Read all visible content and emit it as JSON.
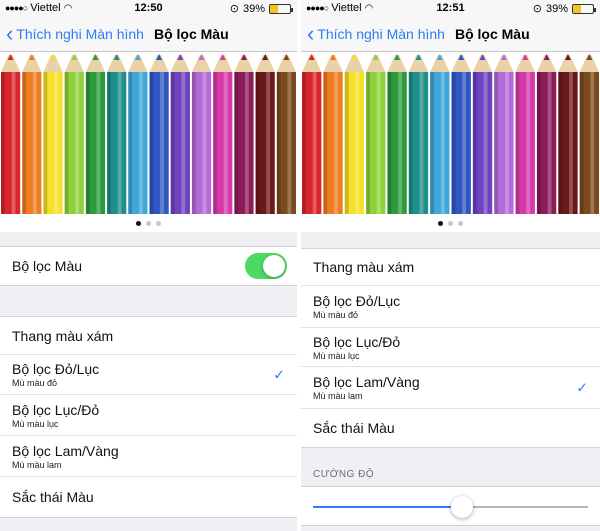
{
  "left": {
    "status": {
      "carrier": "Viettel",
      "time": "12:50",
      "battery_percent": "39%",
      "battery_level": 0.39
    },
    "nav": {
      "back_label": "Thích nghi Màn hình",
      "title": "Bộ lọc Màu"
    },
    "page_dots": {
      "count": 3,
      "active": 0
    },
    "filter_toggle": {
      "label": "Bộ lọc Màu",
      "on": true
    },
    "filters": [
      {
        "title": "Thang màu xám",
        "subtitle": "",
        "checked": false
      },
      {
        "title": "Bộ lọc Đỏ/Lục",
        "subtitle": "Mù màu đỏ",
        "checked": true
      },
      {
        "title": "Bộ lọc Lục/Đỏ",
        "subtitle": "Mù màu lục",
        "checked": false
      },
      {
        "title": "Bộ lọc Lam/Vàng",
        "subtitle": "Mù màu lam",
        "checked": false
      },
      {
        "title": "Sắc thái Màu",
        "subtitle": "",
        "checked": false
      }
    ]
  },
  "right": {
    "status": {
      "carrier": "Viettel",
      "time": "12:51",
      "battery_percent": "39%",
      "battery_level": 0.39
    },
    "nav": {
      "back_label": "Thích nghi Màn hình",
      "title": "Bộ lọc Màu"
    },
    "page_dots": {
      "count": 3,
      "active": 0
    },
    "filters": [
      {
        "title": "Thang màu xám",
        "subtitle": "",
        "checked": false
      },
      {
        "title": "Bộ lọc Đỏ/Lục",
        "subtitle": "Mù màu đỏ",
        "checked": false
      },
      {
        "title": "Bộ lọc Lục/Đỏ",
        "subtitle": "Mù màu lục",
        "checked": false
      },
      {
        "title": "Bộ lọc Lam/Vàng",
        "subtitle": "Mù màu lam",
        "checked": true
      },
      {
        "title": "Sắc thái Màu",
        "subtitle": "",
        "checked": false
      }
    ],
    "intensity": {
      "label": "CƯỜNG ĐỘ",
      "value": 0.54
    }
  },
  "pencil_colors": [
    "#d8262c",
    "#ee7d22",
    "#f6e02a",
    "#8fd13b",
    "#2c9b3d",
    "#1e8f8a",
    "#3fa7d9",
    "#2f57c4",
    "#6f42c1",
    "#b46ad8",
    "#d63aa8",
    "#8c1b5a",
    "#6b1a1a",
    "#7a4a1c"
  ],
  "theme": {
    "accent": "#2f7bf5",
    "toggle_on": "#4cd964"
  }
}
